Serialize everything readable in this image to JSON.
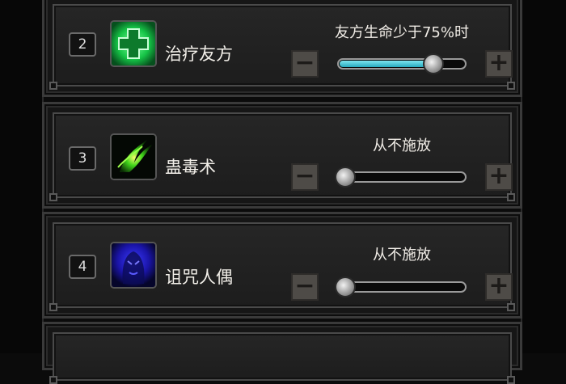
{
  "skills": [
    {
      "number": "2",
      "name": "治疗友方",
      "icon": "green-cross-heal-icon",
      "condition": "友方生命少于75%时",
      "slider_level": 0.75
    },
    {
      "number": "3",
      "name": "蛊毒术",
      "icon": "green-poison-claw-icon",
      "condition": "从不施放",
      "slider_level": 0
    },
    {
      "number": "4",
      "name": "诅咒人偶",
      "icon": "blue-curse-doll-icon",
      "condition": "从不施放",
      "slider_level": 0
    }
  ],
  "buttons": {
    "minus": "−",
    "plus": "+"
  },
  "colors": {
    "slider_fill": "#3bbfd0",
    "heal_green": "#22d45a"
  }
}
